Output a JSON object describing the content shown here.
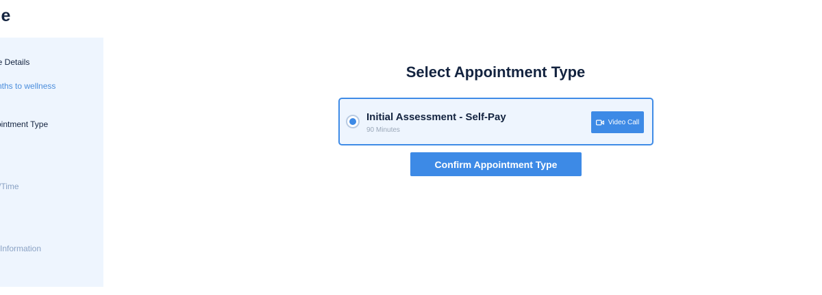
{
  "header": {
    "title": "ge"
  },
  "sidebar": {
    "steps": [
      {
        "label": "ge Details"
      },
      {
        "label": "nths to wellness"
      },
      {
        "label": "ointment Type"
      },
      {
        "label": "/Time"
      },
      {
        "label": "Information"
      }
    ]
  },
  "main": {
    "title": "Select Appointment Type",
    "option": {
      "title": "Initial Assessment - Self-Pay",
      "duration": "90 Minutes",
      "badge_label": "Video Call",
      "badge_icon": "video-camera-icon",
      "selected": true
    },
    "confirm_label": "Confirm Appointment Type"
  },
  "colors": {
    "accent": "#3d8ae6",
    "heading": "#13233f",
    "panel": "#eef5fe"
  }
}
